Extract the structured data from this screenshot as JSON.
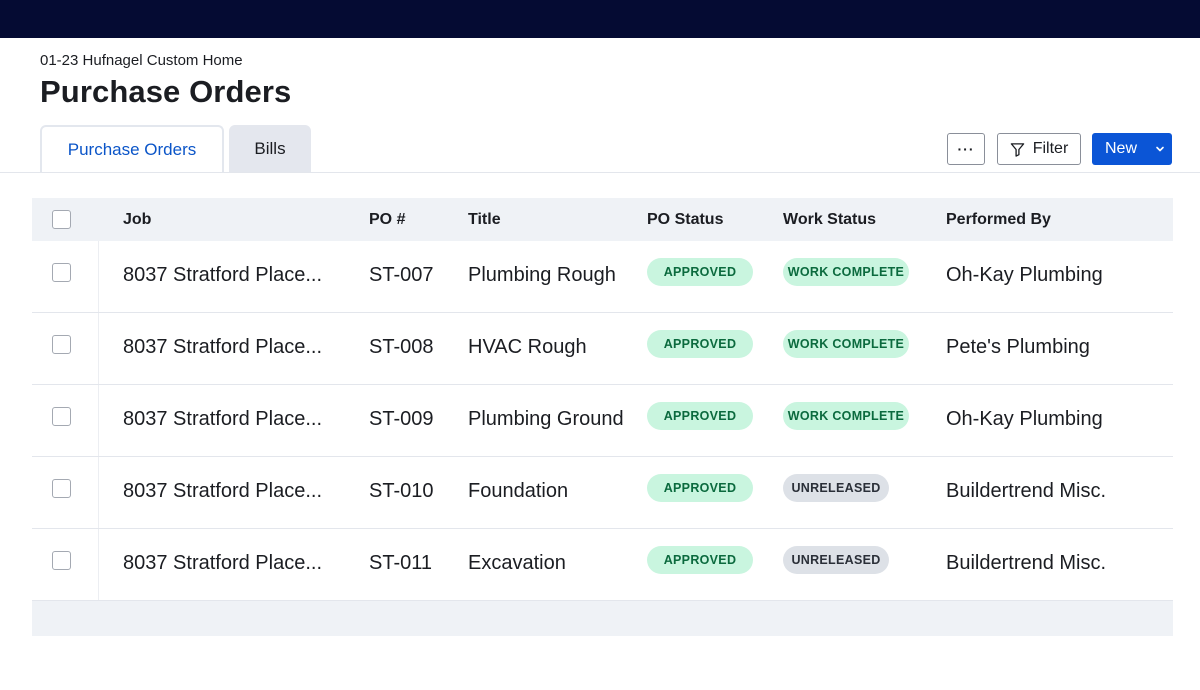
{
  "header": {
    "project_name": "01-23 Hufnagel Custom Home",
    "page_title": "Purchase Orders"
  },
  "tabs": [
    {
      "label": "Purchase Orders",
      "active": true
    },
    {
      "label": "Bills",
      "active": false
    }
  ],
  "toolbar": {
    "more_label": "···",
    "filter_label": "Filter",
    "new_label": "New"
  },
  "table": {
    "columns": [
      "Job",
      "PO #",
      "Title",
      "PO Status",
      "Work Status",
      "Performed By"
    ],
    "rows": [
      {
        "job": "8037 Stratford Place...",
        "po": "ST-007",
        "title": "Plumbing Rough",
        "po_status": "APPROVED",
        "work_status": "WORK COMPLETE",
        "performed_by": "Oh-Kay Plumbing"
      },
      {
        "job": "8037 Stratford Place...",
        "po": "ST-008",
        "title": "HVAC Rough",
        "po_status": "APPROVED",
        "work_status": "WORK COMPLETE",
        "performed_by": "Pete's Plumbing"
      },
      {
        "job": "8037 Stratford Place...",
        "po": "ST-009",
        "title": "Plumbing Ground",
        "po_status": "APPROVED",
        "work_status": "WORK COMPLETE",
        "performed_by": "Oh-Kay Plumbing"
      },
      {
        "job": "8037 Stratford Place...",
        "po": "ST-010",
        "title": "Foundation",
        "po_status": "APPROVED",
        "work_status": "UNRELEASED",
        "performed_by": "Buildertrend Misc."
      },
      {
        "job": "8037 Stratford Place...",
        "po": "ST-011",
        "title": "Excavation",
        "po_status": "APPROVED",
        "work_status": "UNRELEASED",
        "performed_by": "Buildertrend Misc."
      }
    ]
  },
  "colors": {
    "topbar": "#050b33",
    "accent": "#0b55d6",
    "approved_bg": "#c9f5df",
    "approved_text": "#0b6a3e",
    "unreleased_bg": "#dde1e7"
  },
  "icons": {
    "filter": "filter-icon",
    "new_dropdown": "chevron-down-icon"
  }
}
